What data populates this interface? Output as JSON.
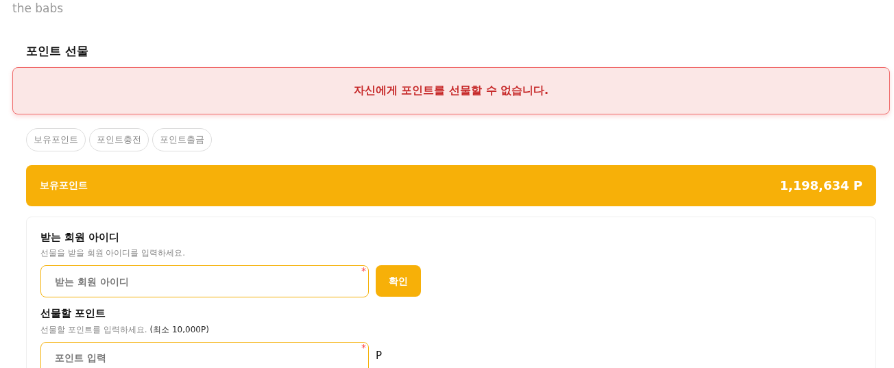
{
  "brand": "the babs",
  "page_title": "포인트 선물",
  "alert": {
    "message": "자신에게 포인트를 선물할 수 없습니다."
  },
  "tabs": [
    {
      "label": "보유포인트"
    },
    {
      "label": "포인트충전"
    },
    {
      "label": "포인트출금"
    }
  ],
  "balance": {
    "label": "보유포인트",
    "amount": "1,198,634 P"
  },
  "form": {
    "fields": [
      {
        "label": "받는 회원 아이디",
        "hint": "선물을 받을 회원 아이디를 입력하세요.",
        "placeholder": "받는 회원 아이디",
        "required_mark": "*",
        "kind": "button",
        "button": "확인"
      },
      {
        "label": "선물할 포인트",
        "hint": "선물할 포인트를 입력하세요.",
        "note": "(최소 10,000P)",
        "placeholder": "포인트 입력",
        "required_mark": "*",
        "kind": "unit",
        "unit": "P"
      }
    ]
  }
}
